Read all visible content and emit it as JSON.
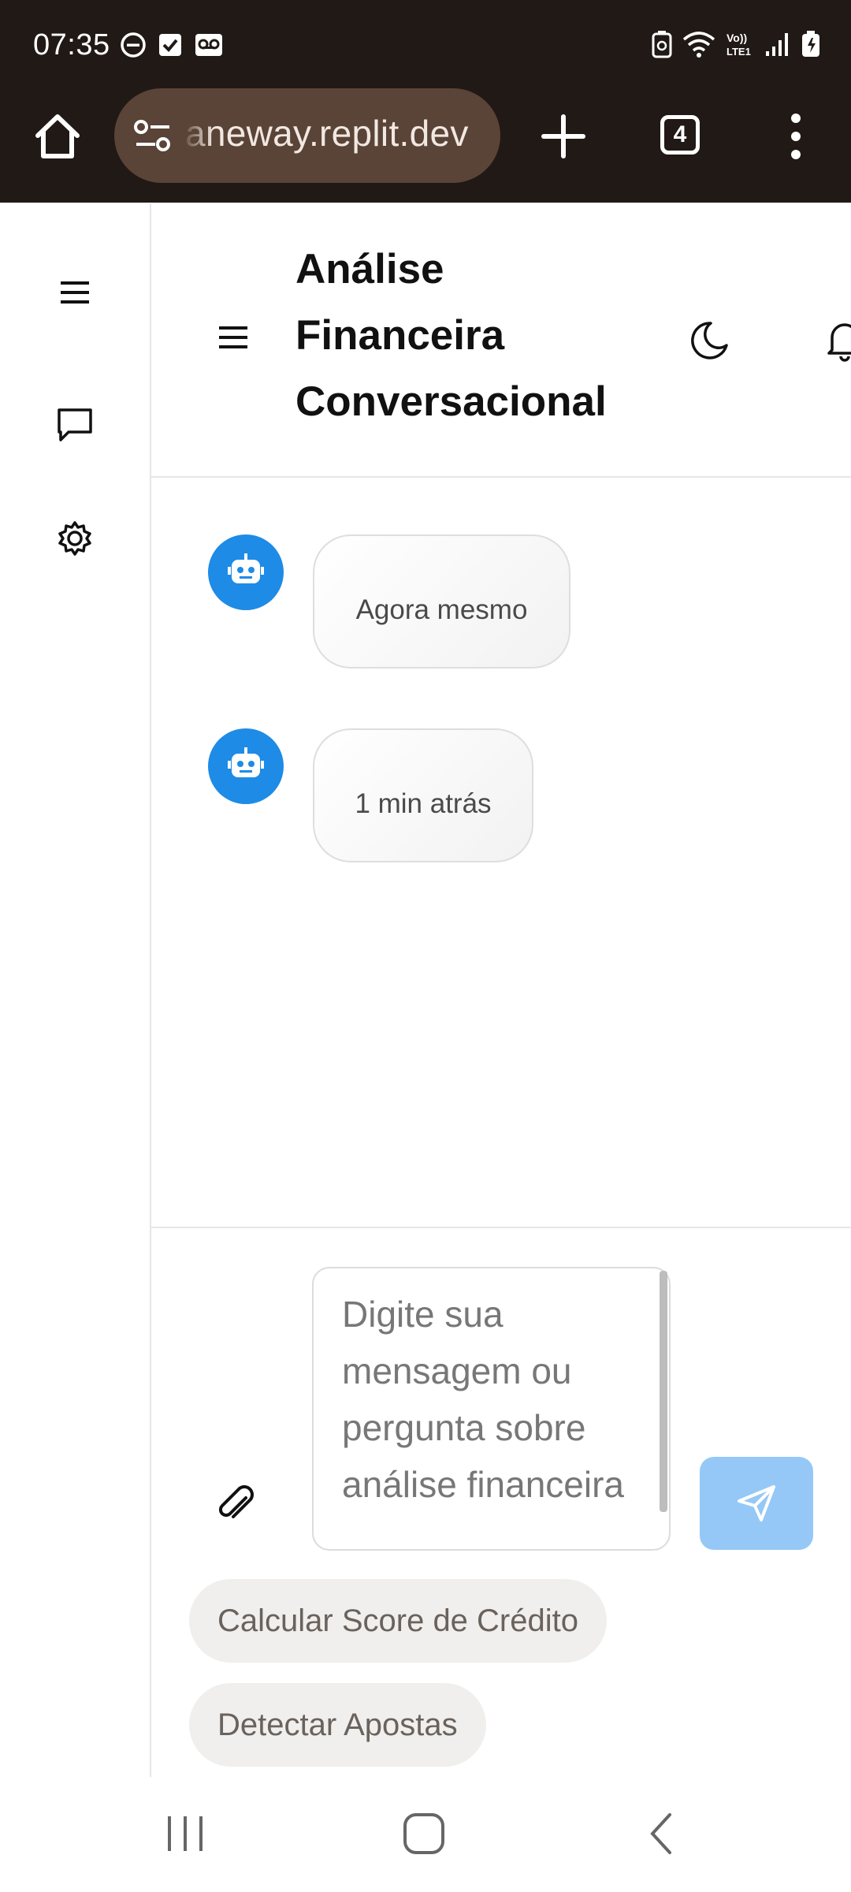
{
  "status_bar": {
    "time": "07:35",
    "icons_left": [
      "do-not-disturb-icon",
      "checkbox-icon",
      "voicemail-icon"
    ],
    "icons_right": [
      "battery-saver-icon",
      "wifi-icon",
      "volte-icon",
      "signal-icon",
      "battery-icon"
    ]
  },
  "browser": {
    "url": "aneway.replit.dev",
    "tab_count": "4"
  },
  "header": {
    "title": "Análise Financeira Conversacional"
  },
  "messages": [
    {
      "sender": "bot",
      "text": "",
      "time": "Agora mesmo"
    },
    {
      "sender": "bot",
      "text": "",
      "time": "1 min atrás"
    }
  ],
  "composer": {
    "placeholder": "Digite sua mensagem ou pergunta sobre análise financeira",
    "value": ""
  },
  "quick_actions": [
    {
      "label": "Calcular Score de Crédito"
    },
    {
      "label": "Detectar Apostas"
    }
  ],
  "colors": {
    "browser_bg": "#211915",
    "url_bg": "#5a4437",
    "avatar": "#1e8be6",
    "send_button": "#95c8f6"
  }
}
